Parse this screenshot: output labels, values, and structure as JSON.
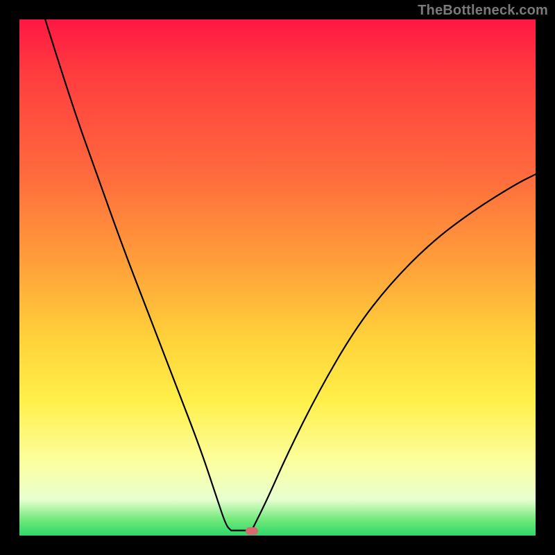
{
  "watermark": "TheBottleneck.com",
  "chart_data": {
    "type": "line",
    "title": "",
    "xlabel": "",
    "ylabel": "",
    "xlim": [
      0,
      100
    ],
    "ylim": [
      0,
      100
    ],
    "grid": false,
    "legend": false,
    "series": [
      {
        "name": "left-branch",
        "x": [
          5,
          10,
          15,
          20,
          25,
          30,
          35,
          38,
          40,
          41
        ],
        "y": [
          100,
          84,
          70,
          56,
          43,
          30,
          17,
          8,
          2,
          1
        ]
      },
      {
        "name": "flat-min",
        "x": [
          41,
          43,
          45
        ],
        "y": [
          1,
          1,
          1
        ]
      },
      {
        "name": "right-branch",
        "x": [
          45,
          48,
          52,
          58,
          65,
          72,
          80,
          88,
          96,
          100
        ],
        "y": [
          1,
          7,
          16,
          28,
          40,
          49,
          57,
          63,
          68,
          70
        ]
      }
    ],
    "marker": {
      "x": 45,
      "y": 1,
      "color": "#d76a6f"
    },
    "background_gradient": {
      "direction": "top-to-bottom",
      "stops": [
        {
          "pos": 0.0,
          "color": "#ff1744"
        },
        {
          "pos": 0.3,
          "color": "#ff6a3d"
        },
        {
          "pos": 0.62,
          "color": "#ffd23a"
        },
        {
          "pos": 0.86,
          "color": "#fbffa0"
        },
        {
          "pos": 1.0,
          "color": "#2fd66a"
        }
      ]
    }
  }
}
